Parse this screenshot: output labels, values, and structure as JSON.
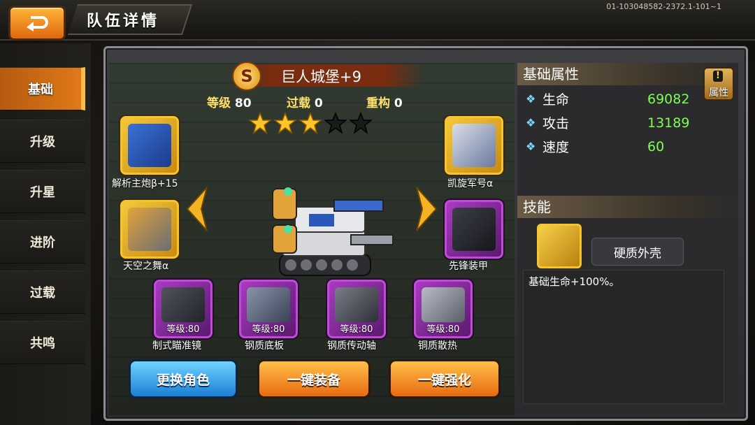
{
  "header": {
    "title": "队伍详情",
    "build_id": "01-103048582-2372.1-101~1"
  },
  "sidebar": {
    "items": [
      {
        "label": "基础",
        "active": true
      },
      {
        "label": "升级"
      },
      {
        "label": "升星"
      },
      {
        "label": "进阶"
      },
      {
        "label": "过载"
      },
      {
        "label": "共鸣"
      }
    ]
  },
  "unit": {
    "rank_badge": "S",
    "name": "巨人城堡+9",
    "level_label": "等级",
    "level": "80",
    "overload_label": "过载",
    "overload": "0",
    "rebuild_label": "重构",
    "rebuild": "0",
    "stars_filled": 3,
    "stars_total": 5
  },
  "equipment": [
    {
      "label": "解析主炮β+15"
    },
    {
      "label": "凯旋军号α"
    },
    {
      "label": "天空之舞α"
    },
    {
      "label": "先锋装甲"
    }
  ],
  "parts": [
    {
      "level": "等级:80",
      "label": "制式瞄准镜"
    },
    {
      "level": "等级:80",
      "label": "钢质底板"
    },
    {
      "level": "等级:80",
      "label": "钢质传动轴"
    },
    {
      "level": "等级:80",
      "label": "铜质散热"
    }
  ],
  "buttons": {
    "change_role": "更换角色",
    "equip_all": "一键装备",
    "enhance_all": "一键强化"
  },
  "attributes": {
    "title": "基础属性",
    "button_label": "属性",
    "button_icon": "!",
    "rows": [
      {
        "name": "生命",
        "value": "69082"
      },
      {
        "name": "攻击",
        "value": "13189"
      },
      {
        "name": "速度",
        "value": "60"
      }
    ]
  },
  "skill": {
    "title": "技能",
    "name": "硬质外壳",
    "description": "基础生命+100%。"
  },
  "colors": {
    "accent": "#e07a18",
    "gold": "#f5c431",
    "purple": "#a93ac0",
    "attr_value": "#7cff52",
    "blue_btn": "#1b7fd6"
  }
}
